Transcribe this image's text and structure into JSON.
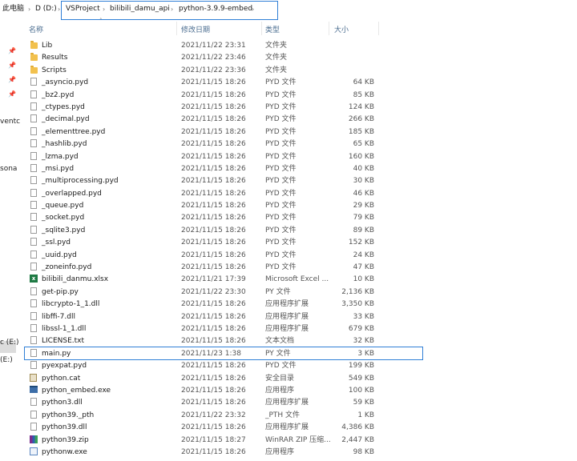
{
  "breadcrumb": {
    "items": [
      "此电脑",
      "D (D:)",
      "VSProject",
      "bilibili_damu_api",
      "python-3.9.9-embed"
    ]
  },
  "columns": {
    "name": "名称",
    "date": "修改日期",
    "type": "类型",
    "size": "大小"
  },
  "left_nav": {
    "labels": [
      "ventc",
      "sona",
      "c (E:)",
      "(E:)"
    ]
  },
  "files": [
    {
      "name": "Lib",
      "date": "2021/11/22 23:31",
      "type": "文件夹",
      "size": "",
      "icon": "folder-icon"
    },
    {
      "name": "Results",
      "date": "2021/11/22 23:46",
      "type": "文件夹",
      "size": "",
      "icon": "folder-icon"
    },
    {
      "name": "Scripts",
      "date": "2021/11/22 23:36",
      "type": "文件夹",
      "size": "",
      "icon": "folder-icon"
    },
    {
      "name": "_asyncio.pyd",
      "date": "2021/11/15 18:26",
      "type": "PYD 文件",
      "size": "64 KB",
      "icon": "file-icon"
    },
    {
      "name": "_bz2.pyd",
      "date": "2021/11/15 18:26",
      "type": "PYD 文件",
      "size": "85 KB",
      "icon": "file-icon"
    },
    {
      "name": "_ctypes.pyd",
      "date": "2021/11/15 18:26",
      "type": "PYD 文件",
      "size": "124 KB",
      "icon": "file-icon"
    },
    {
      "name": "_decimal.pyd",
      "date": "2021/11/15 18:26",
      "type": "PYD 文件",
      "size": "266 KB",
      "icon": "file-icon"
    },
    {
      "name": "_elementtree.pyd",
      "date": "2021/11/15 18:26",
      "type": "PYD 文件",
      "size": "185 KB",
      "icon": "file-icon"
    },
    {
      "name": "_hashlib.pyd",
      "date": "2021/11/15 18:26",
      "type": "PYD 文件",
      "size": "65 KB",
      "icon": "file-icon"
    },
    {
      "name": "_lzma.pyd",
      "date": "2021/11/15 18:26",
      "type": "PYD 文件",
      "size": "160 KB",
      "icon": "file-icon"
    },
    {
      "name": "_msi.pyd",
      "date": "2021/11/15 18:26",
      "type": "PYD 文件",
      "size": "40 KB",
      "icon": "file-icon"
    },
    {
      "name": "_multiprocessing.pyd",
      "date": "2021/11/15 18:26",
      "type": "PYD 文件",
      "size": "30 KB",
      "icon": "file-icon"
    },
    {
      "name": "_overlapped.pyd",
      "date": "2021/11/15 18:26",
      "type": "PYD 文件",
      "size": "46 KB",
      "icon": "file-icon"
    },
    {
      "name": "_queue.pyd",
      "date": "2021/11/15 18:26",
      "type": "PYD 文件",
      "size": "29 KB",
      "icon": "file-icon"
    },
    {
      "name": "_socket.pyd",
      "date": "2021/11/15 18:26",
      "type": "PYD 文件",
      "size": "79 KB",
      "icon": "file-icon"
    },
    {
      "name": "_sqlite3.pyd",
      "date": "2021/11/15 18:26",
      "type": "PYD 文件",
      "size": "89 KB",
      "icon": "file-icon"
    },
    {
      "name": "_ssl.pyd",
      "date": "2021/11/15 18:26",
      "type": "PYD 文件",
      "size": "152 KB",
      "icon": "file-icon"
    },
    {
      "name": "_uuid.pyd",
      "date": "2021/11/15 18:26",
      "type": "PYD 文件",
      "size": "24 KB",
      "icon": "file-icon"
    },
    {
      "name": "_zoneinfo.pyd",
      "date": "2021/11/15 18:26",
      "type": "PYD 文件",
      "size": "47 KB",
      "icon": "file-icon"
    },
    {
      "name": "bilibili_danmu.xlsx",
      "date": "2021/11/21 17:39",
      "type": "Microsoft Excel ...",
      "size": "10 KB",
      "icon": "excel-icon"
    },
    {
      "name": "get-pip.py",
      "date": "2021/11/22 23:30",
      "type": "PY 文件",
      "size": "2,136 KB",
      "icon": "file-icon"
    },
    {
      "name": "libcrypto-1_1.dll",
      "date": "2021/11/15 18:26",
      "type": "应用程序扩展",
      "size": "3,350 KB",
      "icon": "file-icon"
    },
    {
      "name": "libffi-7.dll",
      "date": "2021/11/15 18:26",
      "type": "应用程序扩展",
      "size": "33 KB",
      "icon": "file-icon"
    },
    {
      "name": "libssl-1_1.dll",
      "date": "2021/11/15 18:26",
      "type": "应用程序扩展",
      "size": "679 KB",
      "icon": "file-icon"
    },
    {
      "name": "LICENSE.txt",
      "date": "2021/11/15 18:26",
      "type": "文本文档",
      "size": "32 KB",
      "icon": "file-icon"
    },
    {
      "name": "main.py",
      "date": "2021/11/23 1:38",
      "type": "PY 文件",
      "size": "3 KB",
      "icon": "file-icon",
      "selected": true
    },
    {
      "name": "pyexpat.pyd",
      "date": "2021/11/15 18:26",
      "type": "PYD 文件",
      "size": "199 KB",
      "icon": "file-icon"
    },
    {
      "name": "python.cat",
      "date": "2021/11/15 18:26",
      "type": "安全目录",
      "size": "549 KB",
      "icon": "catalog-icon"
    },
    {
      "name": "python_embed.exe",
      "date": "2021/11/15 18:26",
      "type": "应用程序",
      "size": "100 KB",
      "icon": "exe-icon"
    },
    {
      "name": "python3.dll",
      "date": "2021/11/15 18:26",
      "type": "应用程序扩展",
      "size": "59 KB",
      "icon": "file-icon"
    },
    {
      "name": "python39._pth",
      "date": "2021/11/22 23:32",
      "type": "_PTH 文件",
      "size": "1 KB",
      "icon": "file-icon"
    },
    {
      "name": "python39.dll",
      "date": "2021/11/15 18:26",
      "type": "应用程序扩展",
      "size": "4,386 KB",
      "icon": "file-icon"
    },
    {
      "name": "python39.zip",
      "date": "2021/11/15 18:27",
      "type": "WinRAR ZIP 压缩...",
      "size": "2,447 KB",
      "icon": "zip-icon"
    },
    {
      "name": "pythonw.exe",
      "date": "2021/11/15 18:26",
      "type": "应用程序",
      "size": "98 KB",
      "icon": "python-exe-icon"
    }
  ]
}
